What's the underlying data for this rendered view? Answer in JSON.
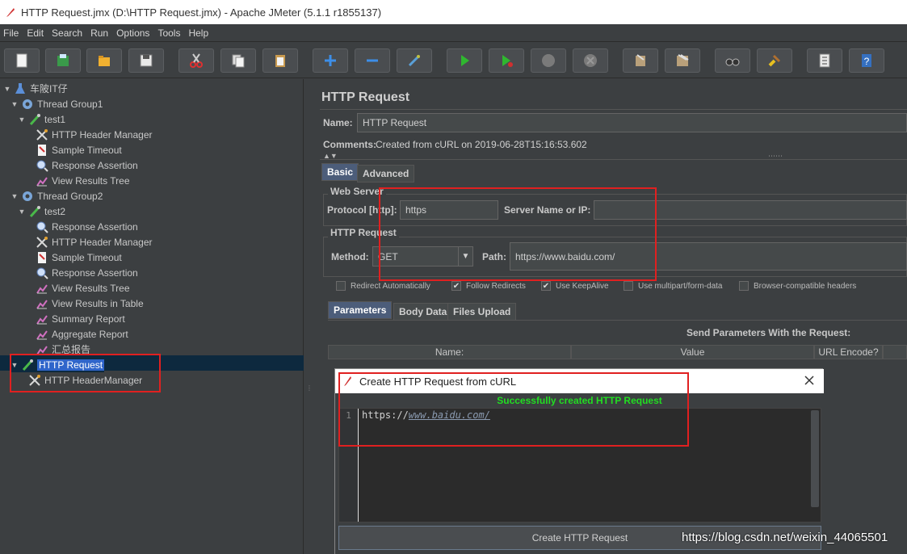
{
  "window": {
    "title": "HTTP Request.jmx (D:\\HTTP Request.jmx) - Apache JMeter (5.1.1 r1855137)"
  },
  "menu": [
    "File",
    "Edit",
    "Search",
    "Run",
    "Options",
    "Tools",
    "Help"
  ],
  "toolbar": {
    "icons": [
      "new-icon",
      "templates-icon",
      "open-icon",
      "save-icon",
      "cut-icon",
      "copy-icon",
      "paste-icon",
      "expand-icon",
      "collapse-icon",
      "toggle-icon",
      "start-icon",
      "start-no-pause-icon",
      "stop-icon",
      "shutdown-icon",
      "clear-icon",
      "clear-all-icon",
      "search-icon",
      "reset-search-icon",
      "function-helper-icon",
      "help-icon"
    ]
  },
  "tree": {
    "items": [
      {
        "label": "车陂IT仔",
        "icon": "flask-icon",
        "level": 0,
        "expanded": true
      },
      {
        "label": "Thread Group1",
        "icon": "gear-icon",
        "level": 1,
        "expanded": true
      },
      {
        "label": "test1",
        "icon": "pipette-icon",
        "level": 2,
        "expanded": true
      },
      {
        "label": "HTTP Header Manager",
        "icon": "tools-icon",
        "level": 3
      },
      {
        "label": "Sample Timeout",
        "icon": "timeout-icon",
        "level": 3
      },
      {
        "label": "Response Assertion",
        "icon": "magnifier-icon",
        "level": 3
      },
      {
        "label": "View Results Tree",
        "icon": "chart-icon",
        "level": 3
      },
      {
        "label": "Thread Group2",
        "icon": "gear-icon",
        "level": 1,
        "expanded": true
      },
      {
        "label": "test2",
        "icon": "pipette-icon",
        "level": 2,
        "expanded": true
      },
      {
        "label": "Response Assertion",
        "icon": "magnifier-icon",
        "level": 3
      },
      {
        "label": "HTTP Header Manager",
        "icon": "tools-icon",
        "level": 3
      },
      {
        "label": "Sample Timeout",
        "icon": "timeout-icon",
        "level": 3
      },
      {
        "label": "Response Assertion",
        "icon": "magnifier-icon",
        "level": 3
      },
      {
        "label": "View Results Tree",
        "icon": "chart-icon",
        "level": 3
      },
      {
        "label": "View Results in Table",
        "icon": "chart-icon",
        "level": 3
      },
      {
        "label": "Summary Report",
        "icon": "chart-icon",
        "level": 3
      },
      {
        "label": "Aggregate Report",
        "icon": "chart-icon",
        "level": 3
      },
      {
        "label": "汇总报告",
        "icon": "chart-icon",
        "level": 3
      },
      {
        "label": "HTTP Request",
        "icon": "pipette-icon",
        "level": 1,
        "expanded": true,
        "selected": true
      },
      {
        "label": "HTTP HeaderManager",
        "icon": "tools-icon",
        "level": 2
      }
    ]
  },
  "panel": {
    "title": "HTTP Request",
    "name_label": "Name:",
    "name_value": "HTTP Request",
    "comments_label": "Comments:",
    "comments_value": "Created from cURL on 2019-06-28T15:16:53.602",
    "tabs": [
      "Basic",
      "Advanced"
    ],
    "web_server_label": "Web Server",
    "protocol_label": "Protocol [http]:",
    "protocol_value": "https",
    "server_label": "Server Name or IP:",
    "server_value": "",
    "http_request_label": "HTTP Request",
    "method_label": "Method:",
    "method_value": "GET",
    "path_label": "Path:",
    "path_value": "https://www.baidu.com/",
    "checkboxes": [
      {
        "label": "Redirect Automatically",
        "checked": false
      },
      {
        "label": "Follow Redirects",
        "checked": true
      },
      {
        "label": "Use KeepAlive",
        "checked": true
      },
      {
        "label": "Use multipart/form-data",
        "checked": false
      },
      {
        "label": "Browser-compatible headers",
        "checked": false
      }
    ],
    "sub_tabs": [
      "Parameters",
      "Body Data",
      "Files Upload"
    ],
    "send_params_label": "Send Parameters With the Request:",
    "columns": [
      "Name:",
      "Value",
      "URL Encode?"
    ]
  },
  "dialog": {
    "title": "Create HTTP Request from cURL",
    "success": "Successfully created HTTP Request",
    "line_number": "1",
    "code_prefix": "https://",
    "code_link": "www.baidu.com/",
    "button": "Create HTTP Request"
  },
  "watermark": "https://blog.csdn.net/weixin_44065501"
}
